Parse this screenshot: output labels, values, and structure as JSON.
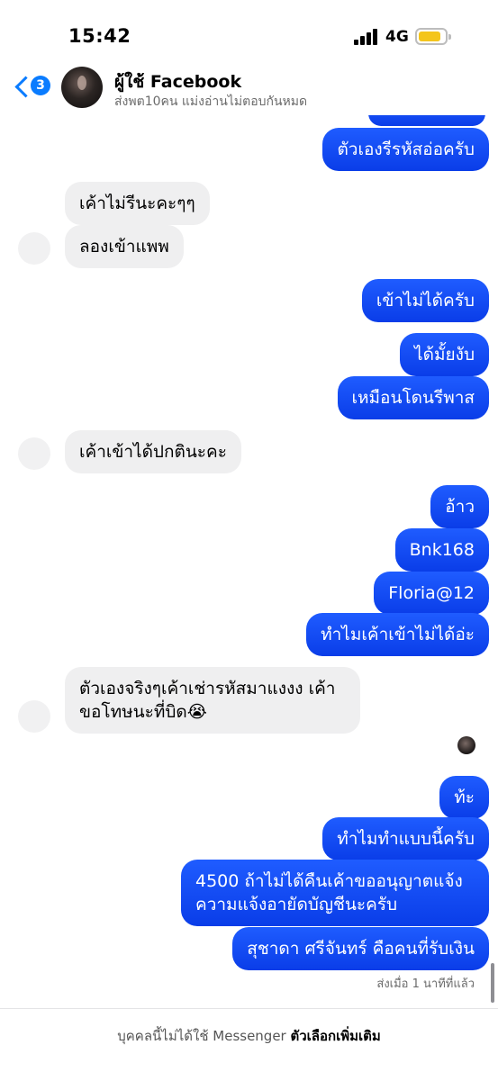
{
  "status_bar": {
    "time": "15:42",
    "network": "4G",
    "battery_level": 0.8,
    "battery_color": "#f4c51c"
  },
  "header": {
    "back_badge": "3",
    "name": "ผู้ใช้ Facebook",
    "subtitle": "ส่งพต10คน แม่งอ่านไม่ตอบกันหมด",
    "accent": "#0a7cff"
  },
  "messages": [
    {
      "side": "out",
      "text": "ตัวเองรีรหัสอ่อครับ"
    },
    {
      "side": "in",
      "text": "เค้าไม่รีนะคะๆๆ"
    },
    {
      "side": "in",
      "text": "ลองเข้าแพพ"
    },
    {
      "side": "out",
      "text": "เข้าไม่ได้ครับ"
    },
    {
      "side": "out",
      "text": "ได้มั้ยงับ"
    },
    {
      "side": "out",
      "text": "เหมือนโดนรีพาส"
    },
    {
      "side": "in",
      "text": "เค้าเข้าได้ปกตินะคะ"
    },
    {
      "side": "out",
      "text": "อ้าว"
    },
    {
      "side": "out",
      "text": "Bnk168"
    },
    {
      "side": "out",
      "text": "Floria@12"
    },
    {
      "side": "out",
      "text": "ทำไมเค้าเข้าไม่ได้อ่ะ"
    },
    {
      "side": "in",
      "line1": "ตัวเองจริงๆเค้าเช่ารหัสมาแงงง เค้า",
      "line2": "ขอโทษนะที่บิด😭"
    },
    {
      "side": "out",
      "text": "ท้ะ"
    },
    {
      "side": "out",
      "text": "ทำไมทำแบบนี้ครับ"
    },
    {
      "side": "out",
      "line1": "4500 ถ้าไม่ได้คืนเค้าขออนุญาตแจ้ง",
      "line2": "ความแจ้งอายัดบัญชีนะครับ"
    },
    {
      "side": "out",
      "text": "สุชาดา ศรีจันทร์ คือคนที่รับเงิน"
    }
  ],
  "sent_status": "ส่งเมื่อ 1 นาทีที่แล้ว",
  "footer": {
    "notice": "บุคคลนี้ไม่ได้ใช้ Messenger",
    "more_options": "ตัวเลือกเพิ่มเติม"
  },
  "colors": {
    "outgoing_bubble": "#1f5cff",
    "incoming_bubble": "#efeff0"
  }
}
